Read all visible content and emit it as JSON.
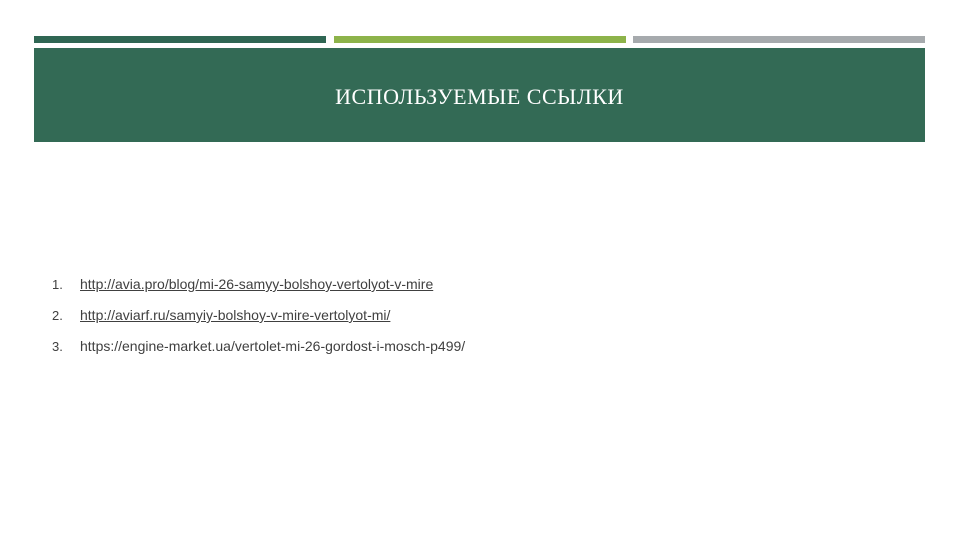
{
  "colors": {
    "bar_1": "#2f6653",
    "bar_2": "#8db34a",
    "bar_3": "#a6aaad",
    "title_band": "#336a55"
  },
  "slide": {
    "title": "ИСПОЛЬЗУЕМЫЕ ССЫЛКИ"
  },
  "references": [
    {
      "number": "1.",
      "url": "http://avia.pro/blog/mi-26-samyy-bolshoy-vertolyot-v-mire"
    },
    {
      "number": "2.",
      "url": "http://aviarf.ru/samyiy-bolshoy-v-mire-vertolyot-mi/"
    },
    {
      "number": "3.",
      "url": "https://engine-market.ua/vertolet-mi-26-gordost-i-mosch-p499/"
    }
  ]
}
